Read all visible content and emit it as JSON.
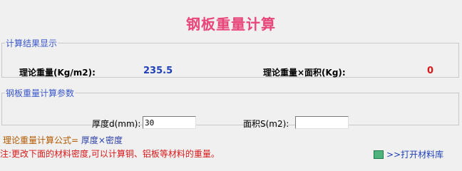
{
  "title": "钢板重量计算",
  "results": {
    "legend": "计算结果显示",
    "theory_weight_label": "理论重量(Kg/m2):",
    "theory_weight_value": "235.5",
    "theory_area_label": "理论重量×面积(Kg):",
    "theory_area_value": "0"
  },
  "params": {
    "legend": "钢板重量计算参数",
    "thickness_label": "厚度d(mm):",
    "thickness_value": "30",
    "area_label": "面积S(m2):",
    "area_value": ""
  },
  "formula": {
    "label": "理论重量计算公式=",
    "expression": "厚度×密度"
  },
  "note": "注:更改下面的材料密度,可以计算铜、铝板等材料的重量。",
  "link_label": ">>打开材料库"
}
